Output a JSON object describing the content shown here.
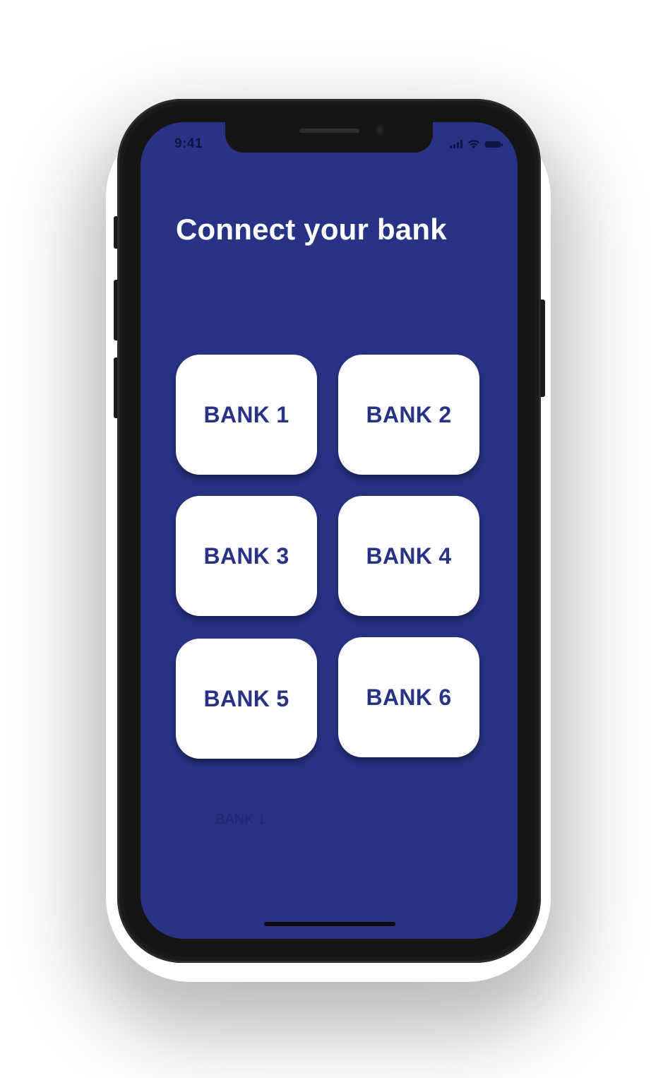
{
  "status_bar": {
    "time": "9:41",
    "icons": [
      "signal-icon",
      "wifi-icon",
      "battery-icon"
    ]
  },
  "screen": {
    "title": "Connect your bank",
    "background_color": "#283386"
  },
  "banks": [
    {
      "label": "BANK 1"
    },
    {
      "label": "BANK 2"
    },
    {
      "label": "BANK 3"
    },
    {
      "label": "BANK 4"
    },
    {
      "label": "BANK 5"
    },
    {
      "label": "BANK 6"
    }
  ],
  "ghost_text": "BANK 1",
  "colors": {
    "accent": "#283386",
    "card": "#ffffff"
  }
}
